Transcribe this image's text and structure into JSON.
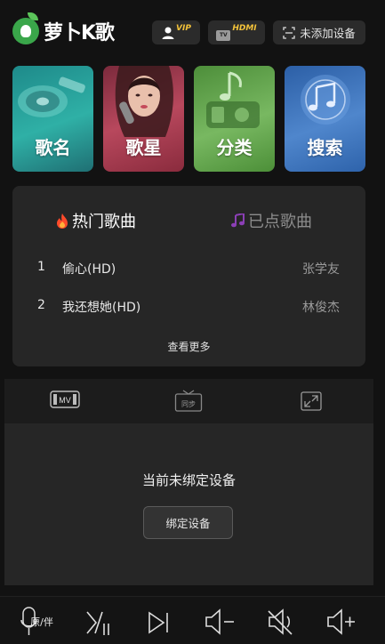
{
  "header": {
    "app_name": "萝卜K歌",
    "vip_label": "VIP",
    "tv_label": "TV",
    "hdmi_label": "HDMI",
    "device_label": "未添加设备"
  },
  "categories": [
    {
      "label": "歌名",
      "icon": "vinyl-record-icon"
    },
    {
      "label": "歌星",
      "icon": "singer-photo"
    },
    {
      "label": "分类",
      "icon": "music-note-icon"
    },
    {
      "label": "搜索",
      "icon": "music-notes-icon"
    }
  ],
  "songs": {
    "tab_hot": "热门歌曲",
    "tab_ordered": "已点歌曲",
    "items": [
      {
        "num": "1",
        "title": "偷心(HD)",
        "artist": "张学友"
      },
      {
        "num": "2",
        "title": "我还想她(HD)",
        "artist": "林俊杰"
      }
    ],
    "more_label": "查看更多"
  },
  "video": {
    "mv_label": "MV",
    "sync_label": "同步",
    "status_text": "当前未绑定设备",
    "bind_button": "绑定设备"
  },
  "controls": {
    "vocal_label": "原/伴",
    "icons": [
      "mic-original-accompany-icon",
      "play-pause-icon",
      "next-track-icon",
      "volume-down-icon",
      "mute-icon",
      "volume-up-icon"
    ]
  },
  "colors": {
    "background": "#121212",
    "panel": "#262626",
    "accent_gold": "#f3c23a",
    "logo_green": "#3aa64a",
    "hot_red": "#ff4a2a",
    "ordered_purple": "#8b3fb5"
  }
}
